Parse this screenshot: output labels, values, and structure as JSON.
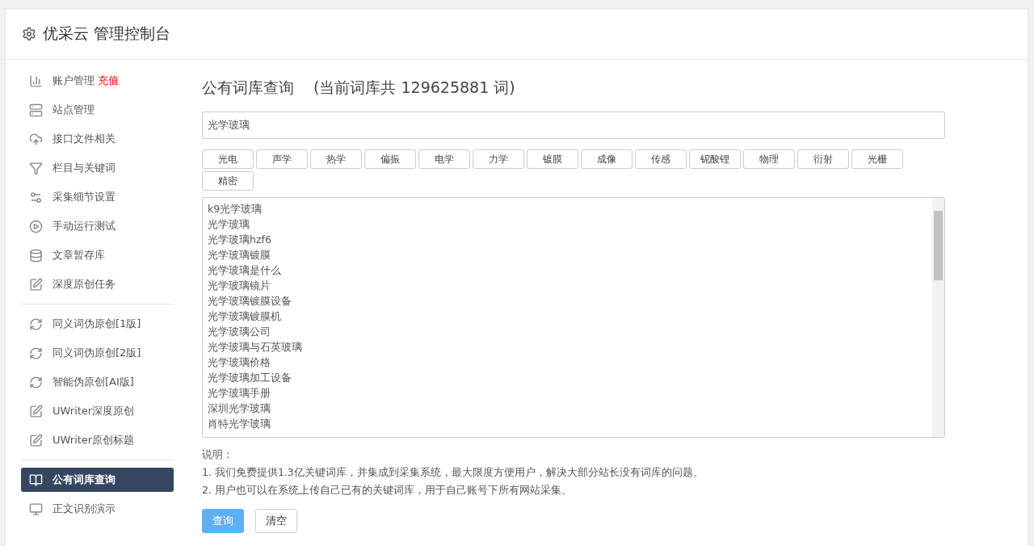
{
  "header": {
    "title": "优采云 管理控制台"
  },
  "sidebar": {
    "groups": [
      {
        "items": [
          {
            "label": "账户管理",
            "badge": "充值",
            "selected": false
          },
          {
            "label": "站点管理",
            "selected": false
          },
          {
            "label": "接口文件相关",
            "selected": false
          },
          {
            "label": "栏目与关键词",
            "selected": false
          },
          {
            "label": "采集细节设置",
            "selected": false
          },
          {
            "label": "手动运行测试",
            "selected": false
          },
          {
            "label": "文章暂存库",
            "selected": false
          },
          {
            "label": "深度原创任务",
            "selected": false
          }
        ]
      },
      {
        "items": [
          {
            "label": "同义词伪原创[1版]",
            "selected": false
          },
          {
            "label": "同义词伪原创[2版]",
            "selected": false
          },
          {
            "label": "智能伪原创[AI版]",
            "selected": false
          },
          {
            "label": "UWriter深度原创",
            "selected": false
          },
          {
            "label": "UWriter原创标题",
            "selected": false
          }
        ]
      },
      {
        "items": [
          {
            "label": "公有词库查询",
            "selected": true
          },
          {
            "label": "正文识别演示",
            "selected": false
          }
        ]
      }
    ]
  },
  "main": {
    "title": "公有词库查询",
    "count_note": "(当前词库共 129625881 词)",
    "search": {
      "value": "光学玻璃"
    },
    "tags": [
      "光电",
      "声学",
      "热学",
      "偏振",
      "电学",
      "力学",
      "镀膜",
      "成像",
      "传感",
      "铌酸锂",
      "物理",
      "衍射",
      "光栅",
      "精密"
    ],
    "results": [
      "k9光学玻璃",
      "光学玻璃",
      "光学玻璃hzf6",
      "光学玻璃镀膜",
      "光学玻璃是什么",
      "光学玻璃镜片",
      "光学玻璃镀膜设备",
      "光学玻璃镀膜机",
      "光学玻璃公司",
      "光学玻璃与石英玻璃",
      "光学玻璃价格",
      "光学玻璃加工设备",
      "光学玻璃手册",
      "深圳光学玻璃",
      "肖特光学玻璃"
    ],
    "notes": {
      "heading": "说明：",
      "lines": [
        "1. 我们免费提供1.3亿关键词库，并集成到采集系统，最大限度方便用户，解决大部分站长没有词库的问题。",
        "2. 用户也可以在系统上传自己已有的关键词库，用于自己账号下所有网站采集。"
      ]
    },
    "buttons": [
      {
        "label": "查询",
        "kind": "primary"
      },
      {
        "label": "清空",
        "kind": "default"
      }
    ]
  }
}
